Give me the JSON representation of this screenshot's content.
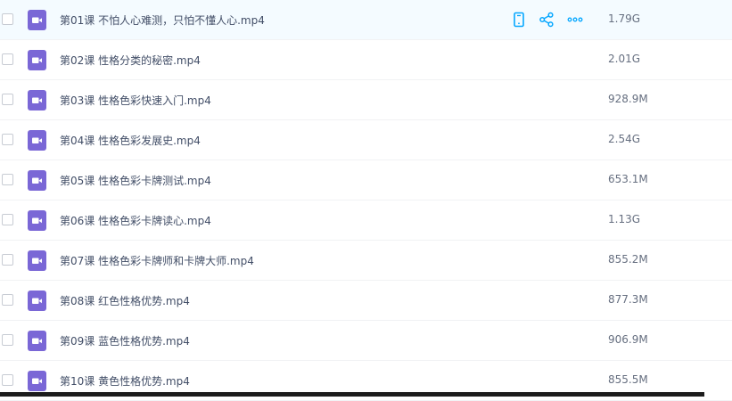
{
  "colors": {
    "accent": "#06a7ff",
    "icon_bg": "#7a67d6",
    "hover_row": "#f4fbff"
  },
  "row_actions": [
    "mobile-icon",
    "share-icon",
    "more-icon"
  ],
  "files": [
    {
      "name": "第01课 不怕人心难测，只怕不懂人心.mp4",
      "size": "1.79G"
    },
    {
      "name": "第02课 性格分类的秘密.mp4",
      "size": "2.01G"
    },
    {
      "name": "第03课 性格色彩快速入门.mp4",
      "size": "928.9M"
    },
    {
      "name": "第04课 性格色彩发展史.mp4",
      "size": "2.54G"
    },
    {
      "name": "第05课 性格色彩卡牌测试.mp4",
      "size": "653.1M"
    },
    {
      "name": "第06课 性格色彩卡牌读心.mp4",
      "size": "1.13G"
    },
    {
      "name": "第07课 性格色彩卡牌师和卡牌大师.mp4",
      "size": "855.2M"
    },
    {
      "name": "第08课 红色性格优势.mp4",
      "size": "877.3M"
    },
    {
      "name": "第09课 蓝色性格优势.mp4",
      "size": "906.9M"
    },
    {
      "name": "第10课 黄色性格优势.mp4",
      "size": "855.5M"
    }
  ]
}
